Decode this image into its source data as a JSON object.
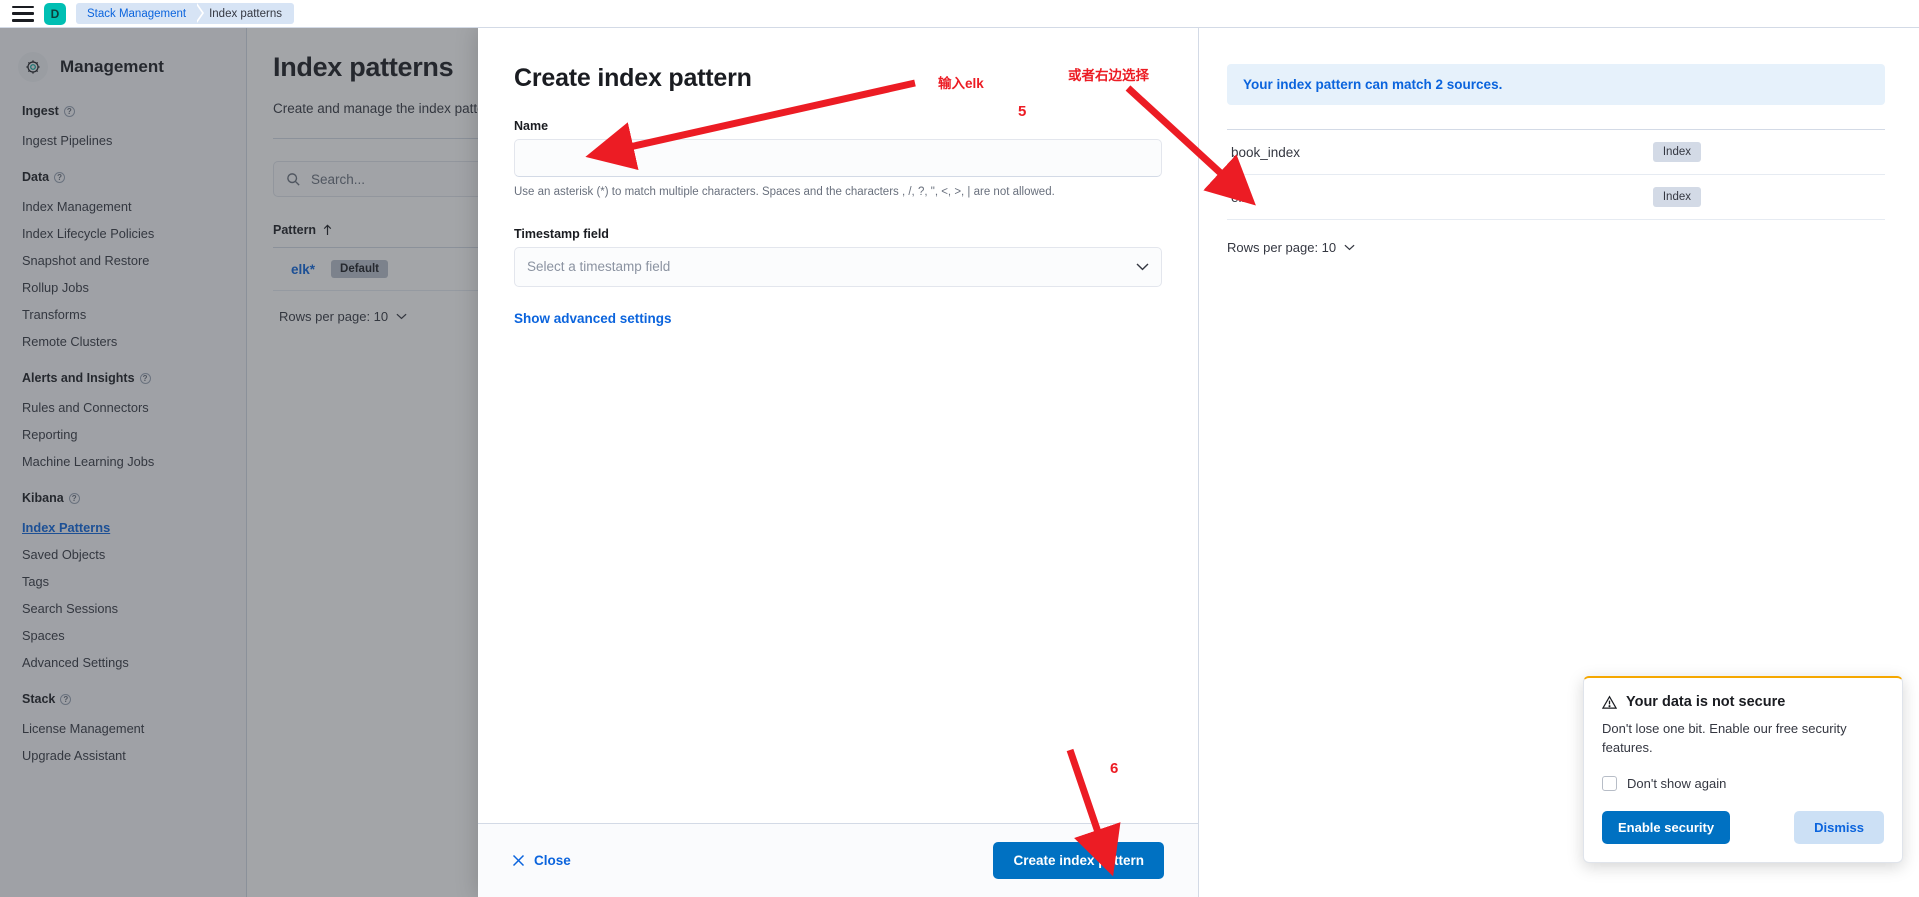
{
  "topbar": {
    "menu_icon": "hamburger-menu-icon",
    "space_initial": "D",
    "breadcrumbs": [
      "Stack Management",
      "Index patterns"
    ]
  },
  "sidebar": {
    "header": "Management",
    "header_icon": "gear-icon",
    "groups": [
      {
        "title": "Ingest",
        "items": [
          {
            "label": "Ingest Pipelines",
            "active": false
          }
        ]
      },
      {
        "title": "Data",
        "items": [
          {
            "label": "Index Management",
            "active": false
          },
          {
            "label": "Index Lifecycle Policies",
            "active": false
          },
          {
            "label": "Snapshot and Restore",
            "active": false
          },
          {
            "label": "Rollup Jobs",
            "active": false
          },
          {
            "label": "Transforms",
            "active": false
          },
          {
            "label": "Remote Clusters",
            "active": false
          }
        ]
      },
      {
        "title": "Alerts and Insights",
        "items": [
          {
            "label": "Rules and Connectors",
            "active": false
          },
          {
            "label": "Reporting",
            "active": false
          },
          {
            "label": "Machine Learning Jobs",
            "active": false
          }
        ]
      },
      {
        "title": "Kibana",
        "items": [
          {
            "label": "Index Patterns",
            "active": true
          },
          {
            "label": "Saved Objects",
            "active": false
          },
          {
            "label": "Tags",
            "active": false
          },
          {
            "label": "Search Sessions",
            "active": false
          },
          {
            "label": "Spaces",
            "active": false
          },
          {
            "label": "Advanced Settings",
            "active": false
          }
        ]
      },
      {
        "title": "Stack",
        "items": [
          {
            "label": "License Management",
            "active": false
          },
          {
            "label": "Upgrade Assistant",
            "active": false
          }
        ]
      }
    ]
  },
  "page": {
    "title": "Index patterns",
    "subtitle": "Create and manage the index patterns that help you retrieve your data from Elasticsearch.",
    "search_placeholder": "Search...",
    "search_icon": "search-icon",
    "table": {
      "column_header": "Pattern",
      "sort_icon": "sort-ascending-arrow-icon",
      "rows": [
        {
          "pattern": "elk*",
          "badge": "Default"
        }
      ]
    },
    "rows_per_page": "Rows per page: 10",
    "rows_per_page_icon": "chevron-down-icon"
  },
  "flyout": {
    "title": "Create index pattern",
    "name_label": "Name",
    "name_value": "",
    "name_placeholder": "",
    "help_text": "Use an asterisk (*) to match multiple characters. Spaces and the characters , /, ?, \", <, >, | are not allowed.",
    "timestamp_label": "Timestamp field",
    "timestamp_placeholder": "Select a timestamp field",
    "timestamp_icon": "chevron-down-icon",
    "advanced_link": "Show advanced settings",
    "close_label": "Close",
    "close_icon": "close-x-icon",
    "submit_label": "Create index pattern",
    "sources": {
      "callout": "Your index pattern can match 2 sources.",
      "rows": [
        {
          "name": "book_index",
          "badge": "Index"
        },
        {
          "name": "elk",
          "badge": "Index"
        }
      ],
      "rows_per_page": "Rows per page: 10",
      "rows_per_page_icon": "chevron-down-icon"
    }
  },
  "toast": {
    "warning_icon": "warning-triangle-icon",
    "title": "Your data is not secure",
    "body": "Don't lose one bit. Enable our free security features.",
    "checkbox_label": "Don't show again",
    "enable_label": "Enable security",
    "dismiss_label": "Dismiss"
  },
  "annotations": {
    "color": "#ec1c24",
    "label_name_input": "输入elk",
    "label_right_panel": "或者右边选择",
    "step_5": "5",
    "step_6": "6"
  }
}
